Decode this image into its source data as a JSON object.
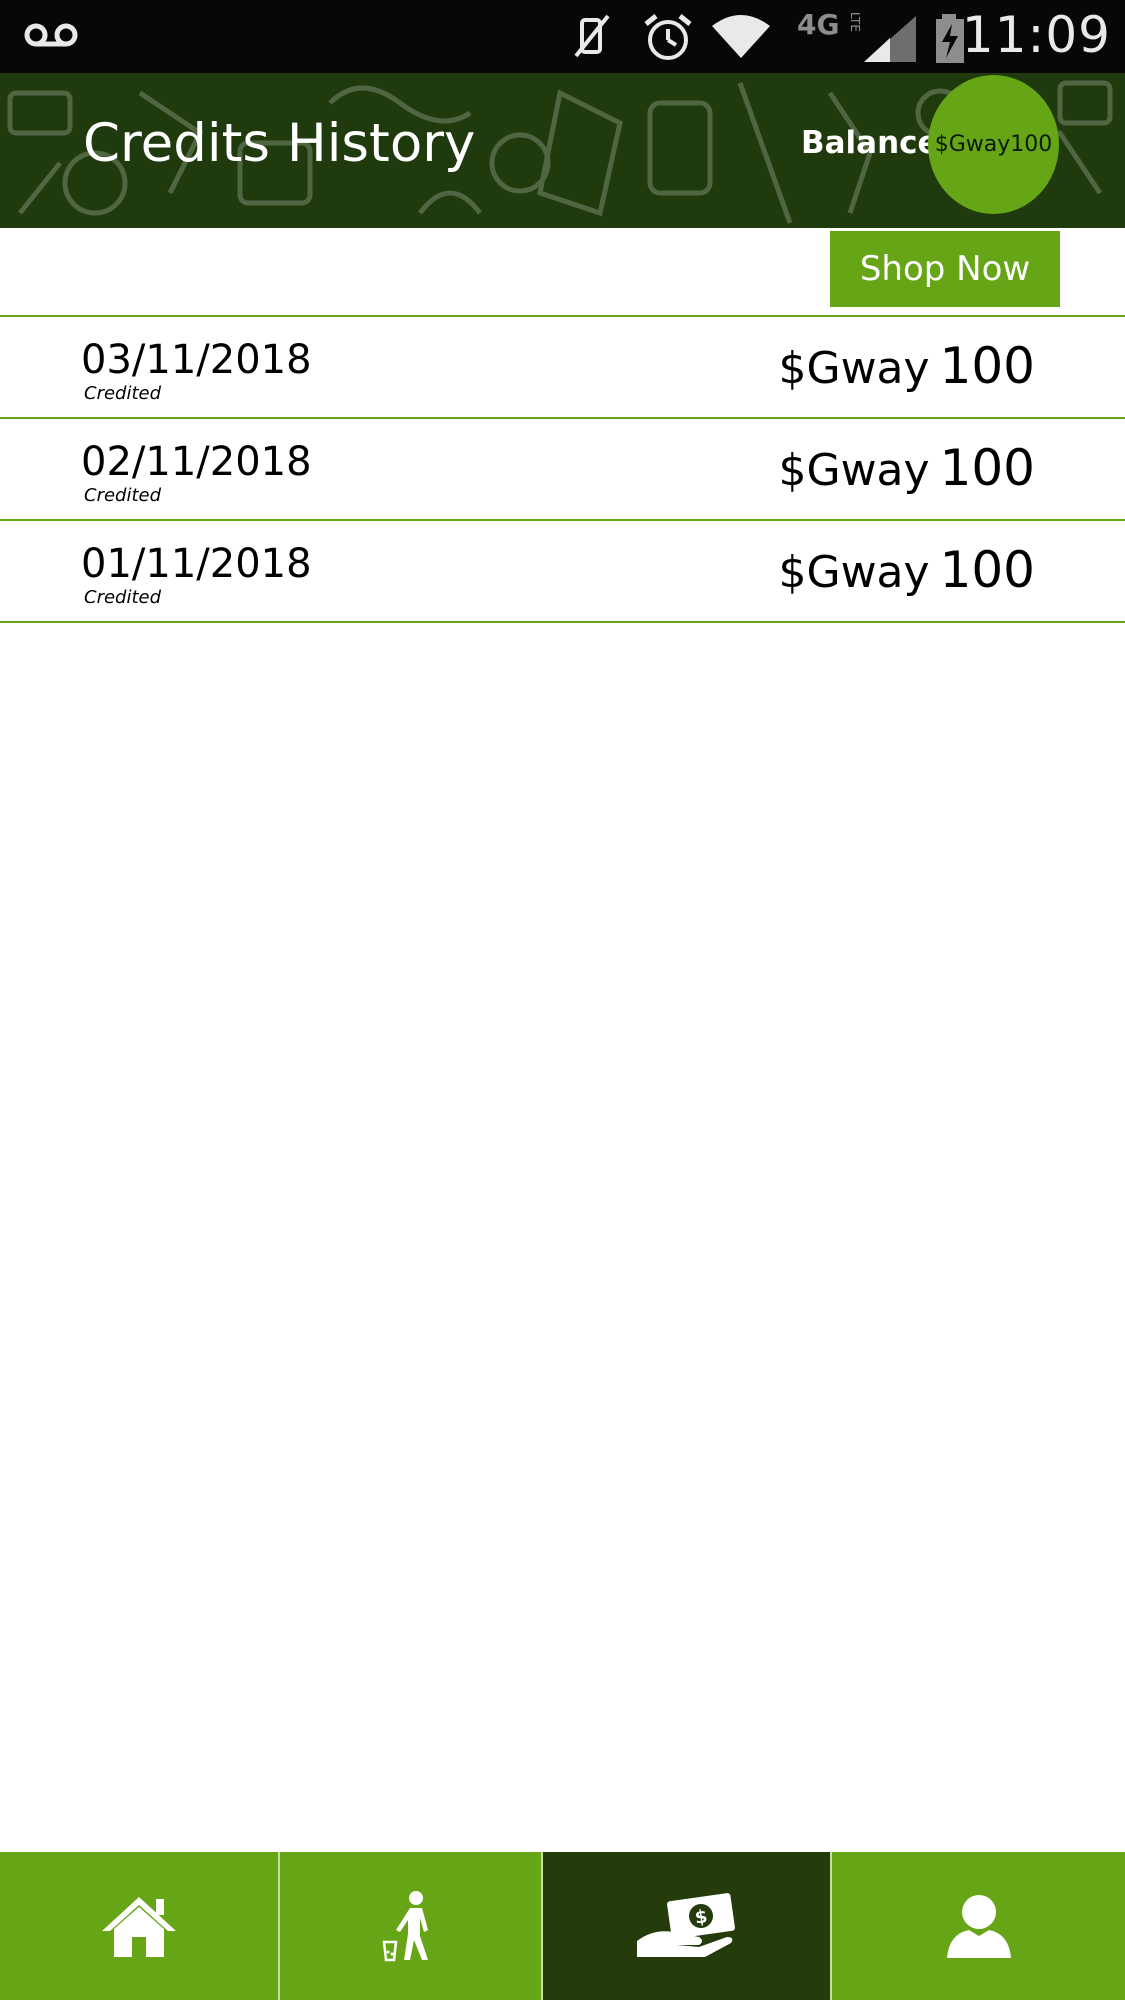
{
  "status_bar": {
    "time": "11:09",
    "network": "4G",
    "network_sub": "LTE",
    "icons": [
      "voicemail-icon",
      "vibrate-off-icon",
      "alarm-icon",
      "wifi-icon",
      "signal-icon",
      "battery-charging-icon"
    ]
  },
  "header": {
    "title": "Credits History",
    "balance_label": "Balance",
    "balance_value": "$Gway100"
  },
  "actions": {
    "shop_now_label": "Shop Now"
  },
  "history": [
    {
      "date": "03/11/2018",
      "status": "Credited",
      "currency": "$Gway",
      "amount": "100"
    },
    {
      "date": "02/11/2018",
      "status": "Credited",
      "currency": "$Gway",
      "amount": "100"
    },
    {
      "date": "01/11/2018",
      "status": "Credited",
      "currency": "$Gway",
      "amount": "100"
    }
  ],
  "bottom_nav": {
    "items": [
      {
        "icon": "home-icon",
        "active": false
      },
      {
        "icon": "recycle-person-icon",
        "active": false
      },
      {
        "icon": "cash-hand-icon",
        "active": true
      },
      {
        "icon": "profile-icon",
        "active": false
      }
    ]
  },
  "colors": {
    "accent": "#66a515",
    "header_bg": "#1f3a0d",
    "nav_active": "#243b0c",
    "status_bar": "#070707"
  }
}
